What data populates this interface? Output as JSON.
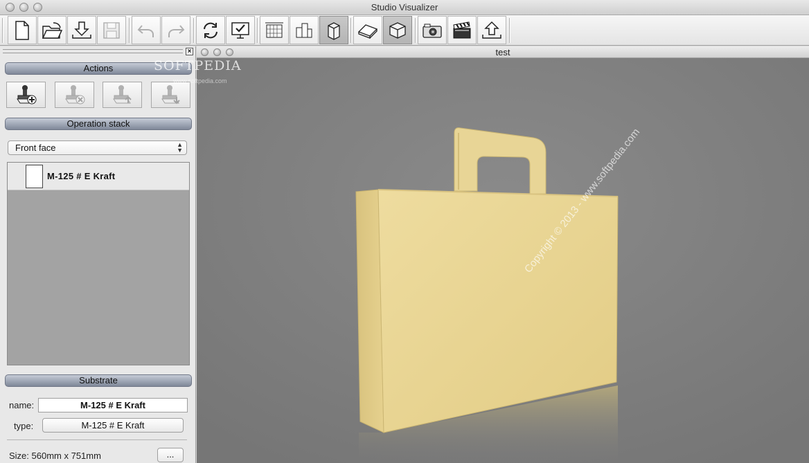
{
  "window": {
    "title": "Studio Visualizer"
  },
  "toolbar": {
    "buttons": [
      {
        "name": "new-document-icon"
      },
      {
        "name": "open-folder-icon"
      },
      {
        "name": "import-icon"
      },
      {
        "name": "save-icon"
      },
      {
        "name": "undo-icon"
      },
      {
        "name": "redo-icon"
      },
      {
        "name": "refresh-icon"
      },
      {
        "name": "validate-icon"
      },
      {
        "name": "grid-view-icon"
      },
      {
        "name": "layout-view-icon"
      },
      {
        "name": "3d-view-icon"
      },
      {
        "name": "flat-box-icon"
      },
      {
        "name": "box-icon"
      },
      {
        "name": "camera-icon"
      },
      {
        "name": "clapper-icon"
      },
      {
        "name": "export-icon"
      }
    ]
  },
  "left_panel": {
    "actions_header": "Actions",
    "operation_stack_header": "Operation stack",
    "face_select": {
      "selected": "Front face"
    },
    "stack_items": [
      {
        "label": "M-125 # E Kraft"
      }
    ],
    "substrate_header": "Substrate",
    "name_label": "name:",
    "name_value": "M-125 # E Kraft",
    "type_label": "type:",
    "type_value": "M-125 # E Kraft",
    "size_label": "Size: 560mm x 751mm",
    "more_button": "..."
  },
  "viewport": {
    "title": "test"
  },
  "watermarks": {
    "softpedia": "SOFTPEDIA",
    "softpedia_sub": "www.softpedia.com",
    "copyright": "Copyright © 2013 - www.softpedia.com"
  },
  "colors": {
    "header_gradient_top": "#c5cbd6",
    "header_gradient_bottom": "#7f8899",
    "viewport_bg": "#7d7d7d",
    "kraft": "#e8d596"
  }
}
